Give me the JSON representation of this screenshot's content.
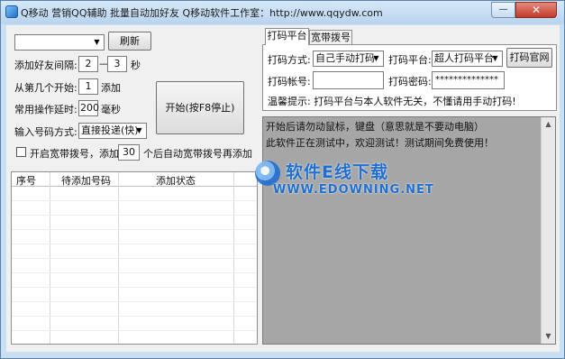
{
  "window": {
    "title": "Q移动 营销QQ辅助  批量自动加好友  Q移动软件工作室：http://www.qqydw.com",
    "close_label": "✕",
    "minimize_label": "—"
  },
  "left": {
    "top_select_value": "",
    "refresh_label": "刷新",
    "interval_label": "添加好友间隔:",
    "interval_min": "2",
    "interval_dash": "—",
    "interval_max": "3",
    "interval_unit": "秒",
    "start_from_label": "从第几个开始:",
    "start_from_value": "1",
    "start_from_suffix": "添加",
    "delay_label": "常用操作延时:",
    "delay_value": "200",
    "delay_unit": "毫秒",
    "input_mode_label": "输入号码方式:",
    "input_mode_value": "直接投递(快)",
    "start_button_label": "开始(按F8停止)",
    "broadband_checkbox_label": "开启宽带拨号，添加:",
    "broadband_count": "30",
    "broadband_suffix": "个后自动宽带拨号再添加"
  },
  "grid": {
    "columns": [
      "序号",
      "待添加号码",
      "添加状态"
    ],
    "rows": []
  },
  "tabs": [
    {
      "label": "打码平台"
    },
    {
      "label": "宽带拨号"
    }
  ],
  "captcha": {
    "method_label": "打码方式:",
    "method_value": "自己手动打码",
    "platform_label": "打码平台:",
    "platform_value": "超人打码平台",
    "official_site_label": "打码官网",
    "account_label": "打码帐号:",
    "account_value": "",
    "password_label": "打码密码:",
    "password_value": "**************",
    "tip": "温馨提示: 打码平台与本人软件无关，不懂请用手动打码!"
  },
  "log": {
    "lines": [
      "开始后请勿动鼠标，键盘（意思就是不要动电脑）",
      "此软件正在测试中，欢迎测试！测试期间免费使用！"
    ]
  },
  "watermark": {
    "title": "软件E线下载",
    "url": "WWW.EDOWNING.NET"
  }
}
